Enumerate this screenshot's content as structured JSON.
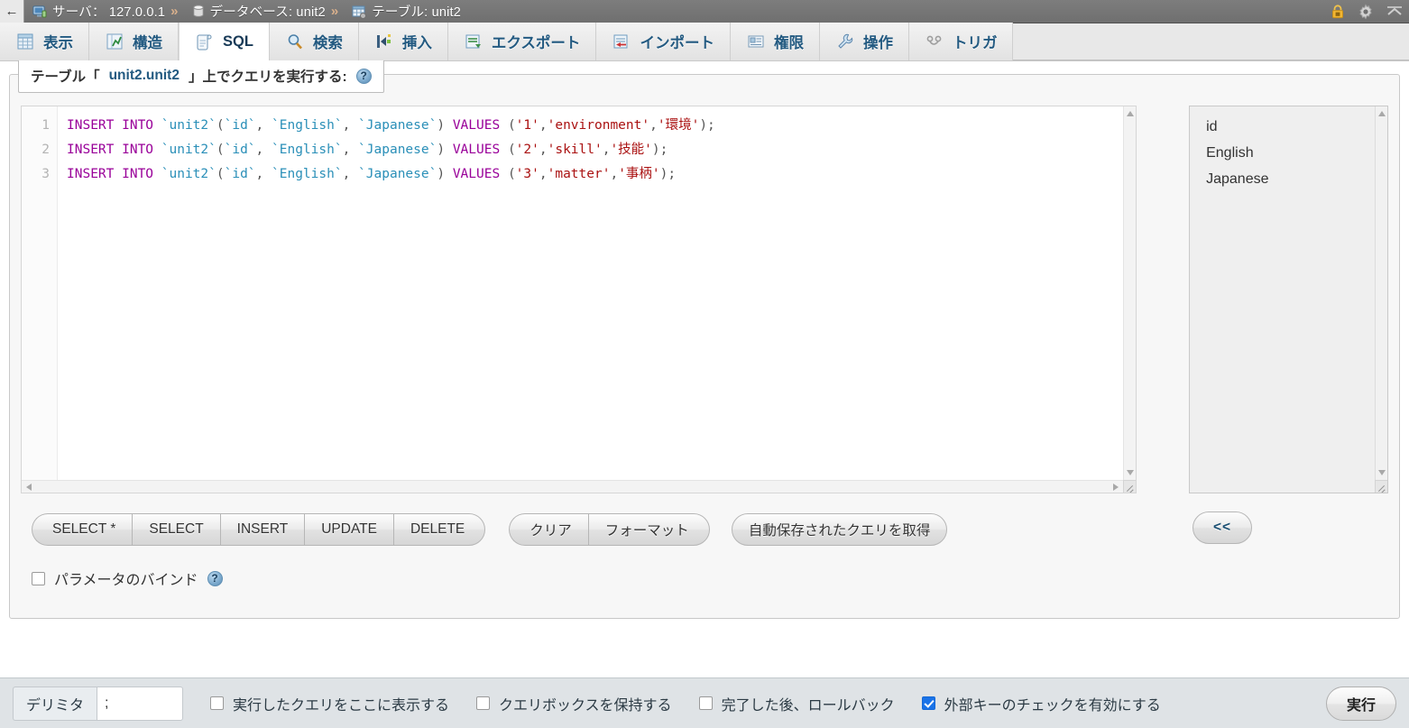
{
  "breadcrumb": {
    "back_arrow": "←",
    "items": [
      {
        "icon": "server-icon",
        "text": "サーバ： 127.0.0.1"
      },
      {
        "icon": "database-icon",
        "text": "データベース: unit2"
      },
      {
        "icon": "table-icon",
        "text": "テーブル: unit2"
      }
    ],
    "separator": "»",
    "right_icons": [
      "padlock-icon",
      "gear-icon",
      "collapse-chevron-icon"
    ]
  },
  "tabs": [
    {
      "label": "表示",
      "icon": "browse-icon",
      "active": false
    },
    {
      "label": "構造",
      "icon": "structure-icon",
      "active": false
    },
    {
      "label": "SQL",
      "icon": "sql-icon",
      "active": true
    },
    {
      "label": "検索",
      "icon": "search-icon",
      "active": false
    },
    {
      "label": "挿入",
      "icon": "insert-icon",
      "active": false
    },
    {
      "label": "エクスポート",
      "icon": "export-icon",
      "active": false
    },
    {
      "label": "インポート",
      "icon": "import-icon",
      "active": false
    },
    {
      "label": "権限",
      "icon": "privileges-icon",
      "active": false
    },
    {
      "label": "操作",
      "icon": "operations-icon",
      "active": false
    },
    {
      "label": "トリガ",
      "icon": "triggers-icon",
      "active": false
    }
  ],
  "panel": {
    "legend_prefix": "テーブル「",
    "legend_table": "unit2.unit2",
    "legend_suffix": "」上でクエリを実行する:",
    "help_glyph": "?"
  },
  "editor": {
    "line_numbers": [
      "1",
      "2",
      "3"
    ],
    "lines": [
      [
        {
          "t": "INSERT INTO ",
          "c": "kw"
        },
        {
          "t": "`unit2`",
          "c": "tick"
        },
        {
          "t": "(",
          "c": "pun"
        },
        {
          "t": "`id`",
          "c": "tick"
        },
        {
          "t": ", ",
          "c": "pun"
        },
        {
          "t": "`English`",
          "c": "tick"
        },
        {
          "t": ", ",
          "c": "pun"
        },
        {
          "t": "`Japanese`",
          "c": "tick"
        },
        {
          "t": ") ",
          "c": "pun"
        },
        {
          "t": "VALUES ",
          "c": "kw"
        },
        {
          "t": "(",
          "c": "pun"
        },
        {
          "t": "'1'",
          "c": "str"
        },
        {
          "t": ",",
          "c": "pun"
        },
        {
          "t": "'environment'",
          "c": "str"
        },
        {
          "t": ",",
          "c": "pun"
        },
        {
          "t": "'環境'",
          "c": "str"
        },
        {
          "t": ");",
          "c": "pun"
        }
      ],
      [
        {
          "t": "INSERT INTO ",
          "c": "kw"
        },
        {
          "t": "`unit2`",
          "c": "tick"
        },
        {
          "t": "(",
          "c": "pun"
        },
        {
          "t": "`id`",
          "c": "tick"
        },
        {
          "t": ", ",
          "c": "pun"
        },
        {
          "t": "`English`",
          "c": "tick"
        },
        {
          "t": ", ",
          "c": "pun"
        },
        {
          "t": "`Japanese`",
          "c": "tick"
        },
        {
          "t": ") ",
          "c": "pun"
        },
        {
          "t": "VALUES ",
          "c": "kw"
        },
        {
          "t": "(",
          "c": "pun"
        },
        {
          "t": "'2'",
          "c": "str"
        },
        {
          "t": ",",
          "c": "pun"
        },
        {
          "t": "'skill'",
          "c": "str"
        },
        {
          "t": ",",
          "c": "pun"
        },
        {
          "t": "'技能'",
          "c": "str"
        },
        {
          "t": ");",
          "c": "pun"
        }
      ],
      [
        {
          "t": "INSERT INTO ",
          "c": "kw"
        },
        {
          "t": "`unit2`",
          "c": "tick"
        },
        {
          "t": "(",
          "c": "pun"
        },
        {
          "t": "`id`",
          "c": "tick"
        },
        {
          "t": ", ",
          "c": "pun"
        },
        {
          "t": "`English`",
          "c": "tick"
        },
        {
          "t": ", ",
          "c": "pun"
        },
        {
          "t": "`Japanese`",
          "c": "tick"
        },
        {
          "t": ") ",
          "c": "pun"
        },
        {
          "t": "VALUES ",
          "c": "kw"
        },
        {
          "t": "(",
          "c": "pun"
        },
        {
          "t": "'3'",
          "c": "str"
        },
        {
          "t": ",",
          "c": "pun"
        },
        {
          "t": "'matter'",
          "c": "str"
        },
        {
          "t": ",",
          "c": "pun"
        },
        {
          "t": "'事柄'",
          "c": "str"
        },
        {
          "t": ");",
          "c": "pun"
        }
      ]
    ],
    "syntax_colors": {
      "keyword": "#990099",
      "identifier": "#2a8fb8",
      "string": "#aa1111",
      "punctuation": "#555555",
      "linenumber": "#b4b4b4"
    }
  },
  "columns": {
    "items": [
      "id",
      "English",
      "Japanese"
    ],
    "insert_button": "<<"
  },
  "buttons": {
    "crud": [
      "SELECT *",
      "SELECT",
      "INSERT",
      "UPDATE",
      "DELETE"
    ],
    "format": [
      "クリア",
      "フォーマット"
    ],
    "autosave": "自動保存されたクエリを取得"
  },
  "bind": {
    "label": "パラメータのバインド",
    "checked": false,
    "help_glyph": "?"
  },
  "bottom": {
    "delimiter_label": "デリミタ",
    "delimiter_value": ";",
    "delimiter_placeholder": ";",
    "checkboxes": [
      {
        "label": "実行したクエリをここに表示する",
        "checked": false
      },
      {
        "label": "クエリボックスを保持する",
        "checked": false
      },
      {
        "label": "完了した後、ロールバック",
        "checked": false
      },
      {
        "label": "外部キーのチェックを有効にする",
        "checked": true
      }
    ],
    "go_label": "実行"
  },
  "theme": {
    "breadcrumb_bg": "#767676",
    "tab_link": "#235a81",
    "accent_checked": "#1a73e8",
    "panel_bg": "#f7f7f7",
    "bottom_bar_bg": "#dfe3e6"
  }
}
